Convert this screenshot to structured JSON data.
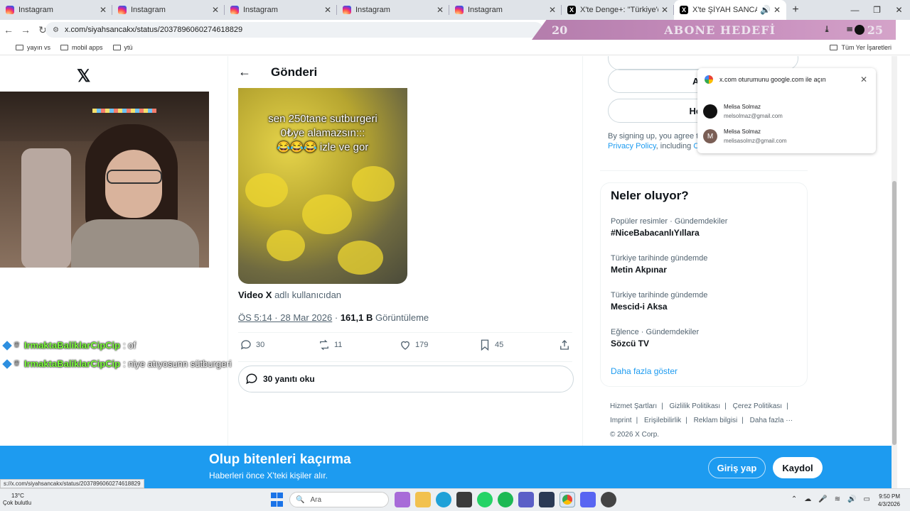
{
  "browser": {
    "tabs": [
      {
        "label": "Instagram",
        "icon": "instagram-icon"
      },
      {
        "label": "Instagram",
        "icon": "instagram-icon"
      },
      {
        "label": "Instagram",
        "icon": "instagram-icon"
      },
      {
        "label": "Instagram",
        "icon": "instagram-icon"
      },
      {
        "label": "Instagram",
        "icon": "instagram-icon"
      },
      {
        "label": "X'te Denge+: \"Türkiye'deki tek",
        "icon": "x-icon"
      },
      {
        "label": "X'te ŞİYAH SANCAK: \"",
        "icon": "x-icon"
      }
    ],
    "url": "x.com/siyahsancakx/status/2037896060274618829",
    "bookmarks": [
      "yayın vs",
      "mobil apps",
      "ytü"
    ],
    "bookmarks_right": "Tüm Yer İşaretleri"
  },
  "stream_overlay": {
    "left_number": "20",
    "goal_label": "ABONE HEDEFİ",
    "right_number": "25"
  },
  "chat": [
    {
      "user": "IrmaktaBaliklarCipCip",
      "message": ": of"
    },
    {
      "user": "IrmaktaBaliklarCipCip",
      "message": ": niye atıyosunn sütburgeri"
    }
  ],
  "post": {
    "header_title": "Gönderi",
    "media_caption": [
      "sen 250tane sutburgeri",
      "0₺ye alamazsın:::",
      "😂😂😂 izle ve gor"
    ],
    "source_user": "Video X",
    "source_suffix": "adlı kullanıcıdan",
    "timestamp": "ÖS 5:14 · 28 Mar 2026",
    "views_count": "161,1 B",
    "views_label": "Görüntüleme",
    "replies": "30",
    "reposts": "11",
    "likes": "179",
    "bookmarks": "45",
    "read_replies": "30 yanıtı oku"
  },
  "sidebar": {
    "apple_button": "Apple",
    "account_button": "Hesap",
    "legal_text": "By signing up, you agree t",
    "privacy_link": "Privacy Policy",
    "legal_suffix": ", including",
    "legal_tail": "C",
    "trends_title": "Neler oluyor?",
    "trends": [
      {
        "context": "Popüler resimler · Gündemdekiler",
        "name": "#NiceBabacanlıYıllara"
      },
      {
        "context": "Türkiye tarihinde gündemde",
        "name": "Metin Akpınar"
      },
      {
        "context": "Türkiye tarihinde gündemde",
        "name": "Mescid-i Aksa"
      },
      {
        "context": "Eğlence · Gündemdekiler",
        "name": "Sözcü TV"
      }
    ],
    "show_more": "Daha fazla göster",
    "footer": [
      "Hizmet Şartları",
      "|",
      "Gizlilik Politikası",
      "|",
      "Çerez Politikası",
      "|",
      "Imprint",
      "|",
      "Erişilebilirlik",
      "|",
      "Reklam bilgisi",
      "|",
      "Daha fazla ···",
      "© 2026 X Corp."
    ]
  },
  "google_popup": {
    "title": "x.com oturumunu google.com ile açın",
    "accounts": [
      {
        "name": "Melisa Solmaz",
        "email": "melsolmaz@gmail.com",
        "initial": ""
      },
      {
        "name": "Melisa Solmaz",
        "email": "melisasolmz@gmail.com",
        "initial": "M"
      }
    ]
  },
  "bottom_banner": {
    "title": "Olup bitenleri kaçırma",
    "subtitle": "Haberleri önce X'teki kişiler alır.",
    "login": "Giriş yap",
    "signup": "Kaydol"
  },
  "status_url": "s://x.com/siyahsancakx/status/2037896060274618829",
  "taskbar": {
    "temperature": "13°C",
    "weather": "Çok bulutlu",
    "search_placeholder": "Ara",
    "time": "9:50 PM",
    "date": "4/3/2026"
  },
  "colors": {
    "accent": "#1d9bf0",
    "chat_user": "#7cfc3c"
  }
}
